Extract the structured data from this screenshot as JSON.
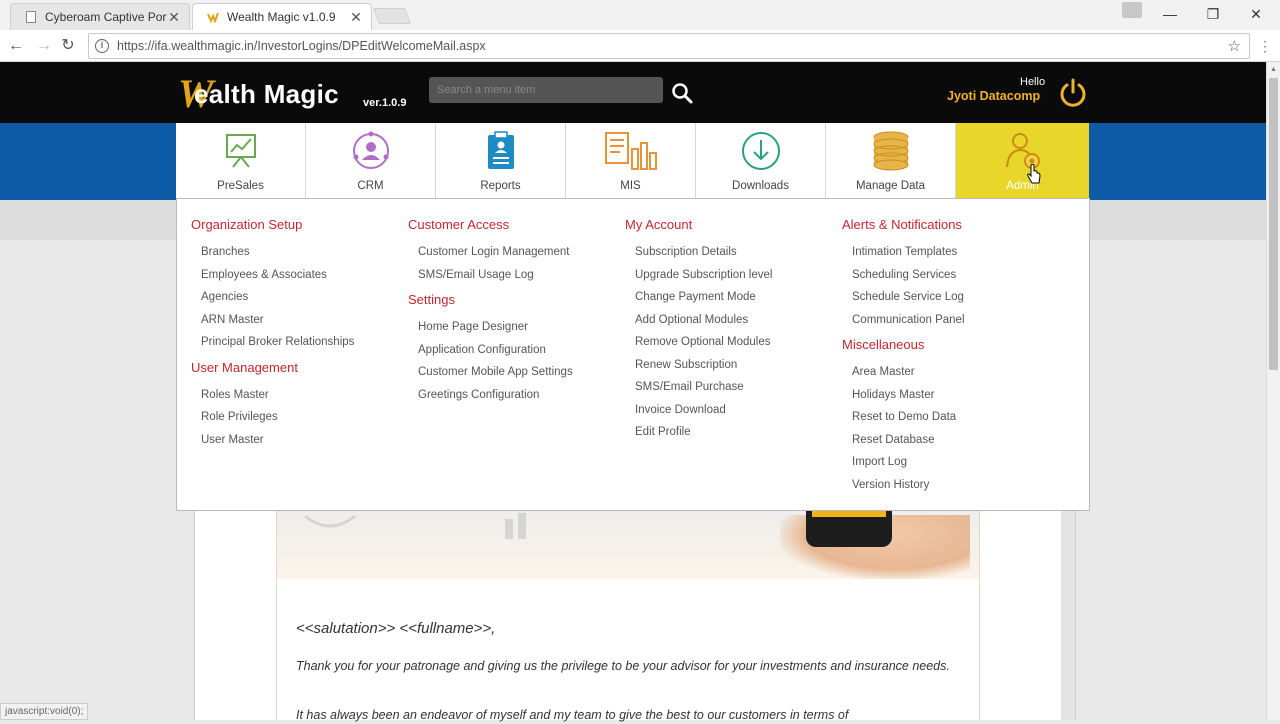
{
  "browser": {
    "tabs": [
      {
        "title": "Cyberoam Captive Portal",
        "close": "✕"
      },
      {
        "title": "Wealth Magic v1.0.9",
        "close": "✕"
      }
    ],
    "url": "https://ifa.wealthmagic.in/InvestorLogins/DPEditWelcomeMail.aspx",
    "window_controls": {
      "minimize": "—",
      "restore": "❐",
      "close": "✕"
    },
    "status_text": "javascript:void(0);"
  },
  "header": {
    "logo_w": "W",
    "logo_text": "ealth Magic",
    "version": "ver.1.0.9",
    "search_placeholder": "Search a menu item",
    "greeting": "Hello",
    "username": "Jyoti Datacomp"
  },
  "nav": {
    "tiles": [
      {
        "label": "PreSales",
        "icon": "presales-chart-icon"
      },
      {
        "label": "CRM",
        "icon": "crm-person-icon"
      },
      {
        "label": "Reports",
        "icon": "reports-clipboard-icon"
      },
      {
        "label": "MIS",
        "icon": "mis-bars-icon"
      },
      {
        "label": "Downloads",
        "icon": "download-icon"
      },
      {
        "label": "Manage Data",
        "icon": "database-coins-icon"
      },
      {
        "label": "Admin",
        "icon": "admin-user-gear-icon",
        "active": true
      }
    ]
  },
  "menu": {
    "col1": {
      "sections": [
        {
          "title": "Organization Setup",
          "items": [
            "Branches",
            "Employees & Associates",
            "Agencies",
            "ARN Master",
            "Principal Broker Relationships"
          ]
        },
        {
          "title": "User Management",
          "items": [
            "Roles Master",
            "Role Privileges",
            "User Master"
          ]
        }
      ]
    },
    "col2": {
      "sections": [
        {
          "title": "Customer Access",
          "items": [
            "Customer Login Management",
            "SMS/Email Usage Log"
          ]
        },
        {
          "title": "Settings",
          "items": [
            "Home Page Designer",
            "Application Configuration",
            "Customer Mobile App Settings",
            "Greetings Configuration"
          ]
        }
      ]
    },
    "col3": {
      "sections": [
        {
          "title": "My Account",
          "items": [
            "Subscription Details",
            "Upgrade Subscription level",
            "Change Payment Mode",
            "Add Optional Modules",
            "Remove Optional Modules",
            "Renew Subscription",
            "SMS/Email Purchase",
            "Invoice Download",
            "Edit Profile"
          ]
        }
      ]
    },
    "col4": {
      "sections": [
        {
          "title": "Alerts & Notifications",
          "items": [
            "Intimation Templates",
            "Scheduling Services",
            "Schedule Service Log",
            "Communication Panel"
          ]
        },
        {
          "title": "Miscellaneous",
          "items": [
            "Area Master",
            "Holidays Master",
            "Reset to Demo Data",
            "Reset Database",
            "Import Log",
            "Version History"
          ]
        }
      ]
    }
  },
  "email": {
    "salutation": "<<salutation>> <<fullname>>,",
    "para1": "Thank you for your patronage and giving us the privilege to be your advisor for your investments and insurance needs.",
    "para2": "It has always been an endeavor of myself and my team to give the best to our customers in terms of"
  },
  "colors": {
    "header_bg": "#0a0a0a",
    "brand_gold": "#e0a51b",
    "nav_blue": "#0d5aa7",
    "admin_active": "#e8d62b",
    "menu_title_red": "#c4262e"
  }
}
